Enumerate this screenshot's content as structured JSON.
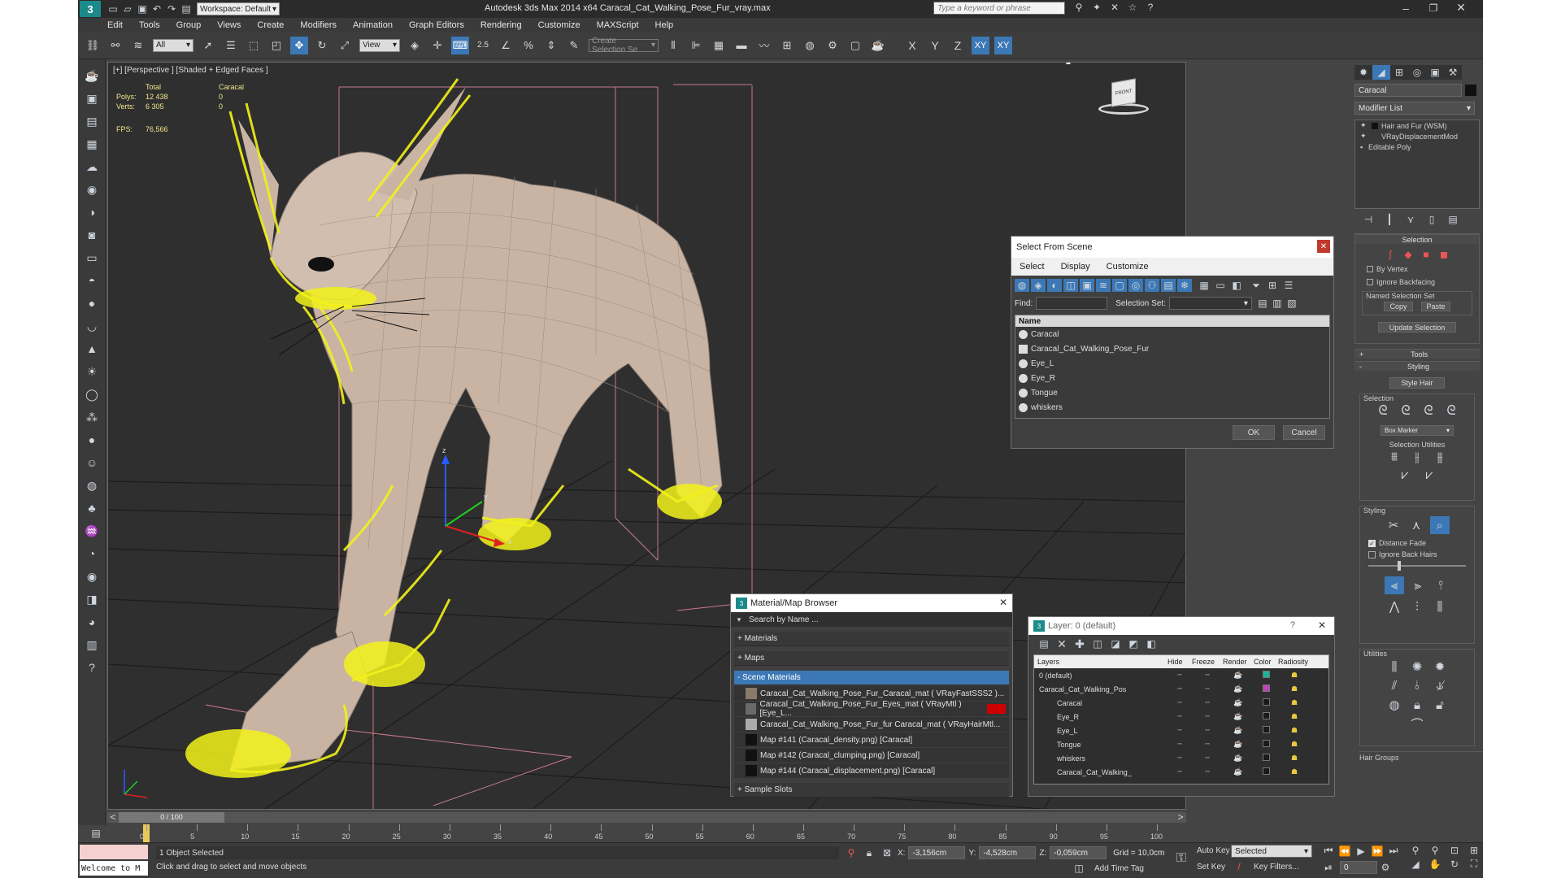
{
  "title_bar": {
    "workspace": "Workspace: Default",
    "app_title": "Autodesk 3ds Max  2014 x64     Caracal_Cat_Walking_Pose_Fur_vray.max",
    "search_placeholder": "Type a keyword or phrase"
  },
  "menu": [
    "Edit",
    "Tools",
    "Group",
    "Views",
    "Create",
    "Modifiers",
    "Animation",
    "Graph Editors",
    "Rendering",
    "Customize",
    "MAXScript",
    "Help"
  ],
  "toolbar": {
    "filter_dropdown": "All",
    "ref_coord_dropdown": "View",
    "snap_label": "2.5",
    "selection_set_placeholder": "Create Selection Se",
    "axis_x": "X",
    "axis_y": "Y",
    "axis_z": "Z",
    "axis_xy": "XY",
    "axis_xy2": "XY"
  },
  "viewport": {
    "label": "[+] [Perspective ] [Shaded + Edged Faces ]",
    "stats": {
      "total_header": "Total",
      "object_header": "Caracal",
      "polys_label": "Polys:",
      "polys_total": "12 438",
      "polys_obj": "0",
      "verts_label": "Verts:",
      "verts_total": "6 305",
      "verts_obj": "0",
      "fps_label": "FPS:",
      "fps_value": "76,566"
    },
    "viewcube_label": "FRONT"
  },
  "command_panel": {
    "object_name": "Caracal",
    "modifier_list": "Modifier List",
    "stack": [
      "Hair and Fur (WSM)",
      "VRayDisplacementMod",
      "Editable Poly"
    ],
    "selection_title": "Selection",
    "by_vertex": "By Vertex",
    "ignore_backfacing": "Ignore Backfacing",
    "named_selection_set": "Named Selection Set",
    "copy": "Copy",
    "paste": "Paste",
    "update_selection": "Update Selection",
    "tools": "Tools",
    "styling": "Styling",
    "style_hair": "Style Hair",
    "selection2": "Selection",
    "box_marker": "Box Marker",
    "selection_utilities": "Selection Utilities",
    "styling2": "Styling",
    "distance_fade": "Distance Fade",
    "ignore_back_hairs": "Ignore Back Hairs",
    "utilities": "Utilities",
    "hair_groups": "Hair Groups"
  },
  "select_from_scene": {
    "title": "Select From Scene",
    "tabs": [
      "Select",
      "Display",
      "Customize"
    ],
    "find_label": "Find:",
    "selection_set_label": "Selection Set:",
    "column_name": "Name",
    "items": [
      "Caracal",
      "Caracal_Cat_Walking_Pose_Fur",
      "Eye_L",
      "Eye_R",
      "Tongue",
      "whiskers"
    ],
    "ok": "OK",
    "cancel": "Cancel"
  },
  "material_browser": {
    "title": "Material/Map Browser",
    "search_placeholder": "Search by Name ...",
    "sections": {
      "materials": "+ Materials",
      "maps": "+ Maps",
      "scene_materials": "- Scene Materials",
      "sample_slots": "+ Sample Slots"
    },
    "items": [
      "Caracal_Cat_Walking_Pose_Fur_Caracal_mat  ( VRayFastSSS2 )...",
      "Caracal_Cat_Walking_Pose_Fur_Eyes_mat  ( VRayMtl ) [Eye_L...",
      "Caracal_Cat_Walking_Pose_Fur_fur Caracal_mat  ( VRayHairMtl...",
      "Map #141 (Caracal_density.png)  [Caracal]",
      "Map #142 (Caracal_clumping.png)  [Caracal]",
      "Map #144 (Caracal_displacement.png)  [Caracal]"
    ]
  },
  "layer_dialog": {
    "title": "Layer: 0 (default)",
    "help": "?",
    "columns": [
      "Layers",
      "Hide",
      "Freeze",
      "Render",
      "Color",
      "Radiosity"
    ],
    "layers": [
      {
        "name": "0 (default)",
        "color": "#19b39b",
        "indent": 0
      },
      {
        "name": "Caracal_Cat_Walking_Pos",
        "color": "#c040c0",
        "indent": 0
      },
      {
        "name": "Caracal",
        "color": "#1a1a1a",
        "indent": 1
      },
      {
        "name": "Eye_R",
        "color": "#1a1a1a",
        "indent": 1
      },
      {
        "name": "Eye_L",
        "color": "#1a1a1a",
        "indent": 1
      },
      {
        "name": "Tongue",
        "color": "#1a1a1a",
        "indent": 1
      },
      {
        "name": "whiskers",
        "color": "#1a1a1a",
        "indent": 1
      },
      {
        "name": "Caracal_Cat_Walking_",
        "color": "#1a1a1a",
        "indent": 1
      }
    ]
  },
  "timeline": {
    "frame_counter": "0 / 100",
    "ticks": [
      "0",
      "5",
      "10",
      "15",
      "20",
      "25",
      "30",
      "35",
      "40",
      "45",
      "50",
      "55",
      "60",
      "65",
      "70",
      "75",
      "80",
      "85",
      "90",
      "95",
      "100"
    ]
  },
  "status": {
    "maxscript": "Welcome to M",
    "selected": "1 Object Selected",
    "prompt": "Click and drag to select and move objects",
    "x_label": "X:",
    "x_value": "-3,156cm",
    "y_label": "Y:",
    "y_value": "-4,528cm",
    "z_label": "Z:",
    "z_value": "-0,059cm",
    "grid": "Grid = 10,0cm",
    "add_time_tag": "Add Time Tag",
    "auto_key": "Auto Key",
    "set_key": "Set Key",
    "selected_dropdown": "Selected",
    "key_filters": "Key Filters...",
    "frame": "0"
  },
  "colors": {
    "accent": "#3c78b5",
    "fur": "#f2f21a",
    "mesh": "#c9b4a4",
    "timeline_marker": "#f0d060"
  }
}
